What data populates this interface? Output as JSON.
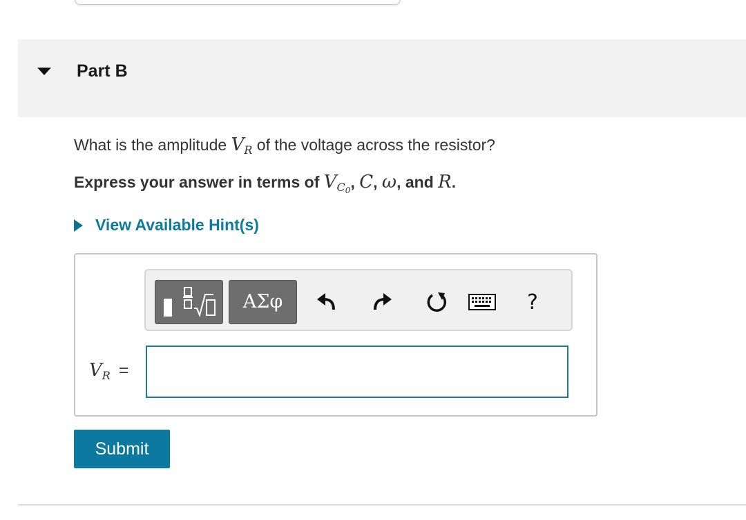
{
  "part": {
    "title": "Part B"
  },
  "question": {
    "prefix": "What is the amplitude ",
    "variable": "V",
    "variable_sub": "R",
    "suffix": " of the voltage across the resistor?"
  },
  "instruction": {
    "prefix": "Express your answer in terms of ",
    "vc0_main": "V",
    "vc0_sub": "C",
    "vc0_subsub": "0",
    "sep1": ", ",
    "c": "C",
    "sep2": ", ",
    "omega": "ω",
    "sep3": ", and ",
    "r": "R",
    "end": "."
  },
  "hint": {
    "label": "View Available Hint(s)"
  },
  "toolbar": {
    "symbols_label": "ΑΣφ",
    "help_label": "?",
    "icons": [
      "templates-icon",
      "greek-symbols-icon",
      "undo-icon",
      "redo-icon",
      "reset-icon",
      "keyboard-icon",
      "help-icon"
    ]
  },
  "answer": {
    "var_main": "V",
    "var_sub": "R",
    "equals": "=",
    "value": ""
  },
  "submit": {
    "label": "Submit"
  },
  "colors": {
    "accent": "#0c7aa0",
    "link": "#0f7b9b",
    "header_bg": "#f2f2f2",
    "toolbar_button": "#6e6e6e"
  }
}
